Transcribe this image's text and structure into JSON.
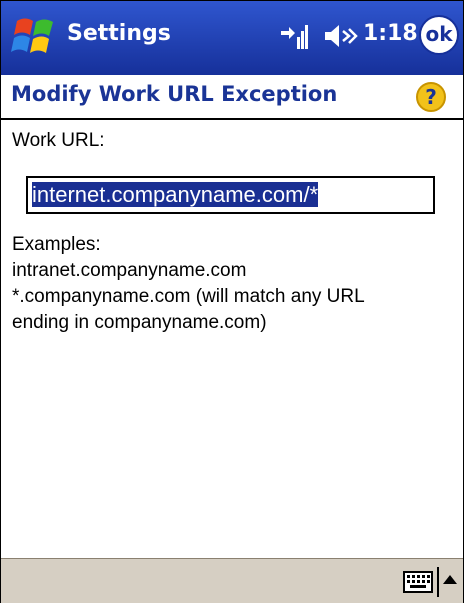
{
  "titlebar": {
    "app_title": "Settings",
    "clock": "1:18",
    "ok_label": "ok"
  },
  "page": {
    "title": "Modify Work URL Exception",
    "help_label": "?"
  },
  "form": {
    "url_label": "Work URL:",
    "url_value": "internet.companyname.com/*"
  },
  "examples": {
    "heading": "Examples:",
    "lines": [
      "intranet.companyname.com",
      "*.companyname.com (will match any URL",
      "ending in companyname.com)"
    ]
  },
  "icons": {
    "start": "windows-flag-icon",
    "connectivity": "connectivity-icon",
    "volume": "speaker-icon",
    "keyboard": "keyboard-icon",
    "sip_menu": "up-arrow-icon"
  },
  "colors": {
    "titlebar": "#1d3aa8",
    "page_title": "#1a3496",
    "selection": "#1a2f93",
    "menubar": "#d6cfc3"
  }
}
